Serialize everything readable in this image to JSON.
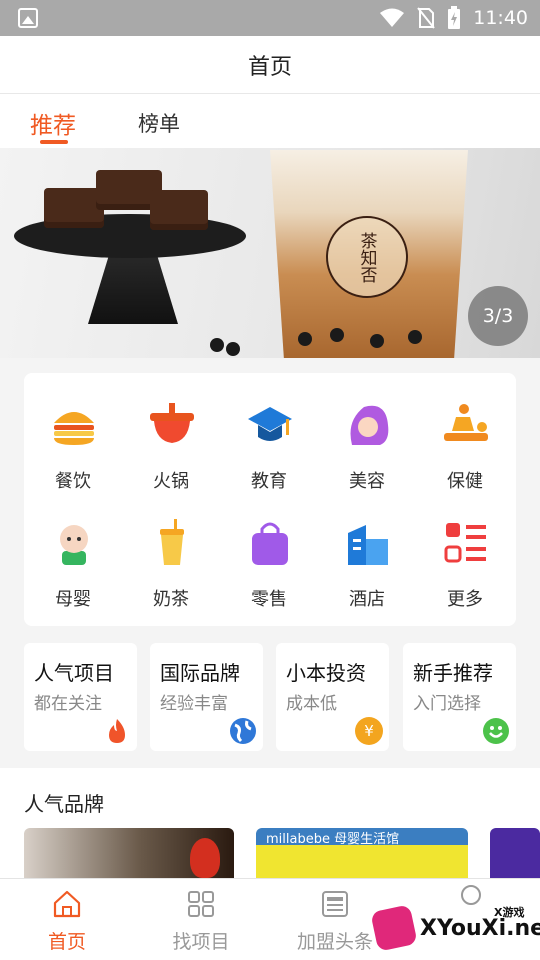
{
  "status_bar": {
    "time": "11:40"
  },
  "header": {
    "title": "首页"
  },
  "tabs": [
    {
      "label": "推荐",
      "active": true
    },
    {
      "label": "榜单",
      "active": false
    }
  ],
  "banner": {
    "brand_text": "茶知否",
    "counter": "3/3"
  },
  "categories": [
    {
      "label": "餐饮",
      "icon": "burger-icon"
    },
    {
      "label": "火锅",
      "icon": "hotpot-icon"
    },
    {
      "label": "教育",
      "icon": "graduation-cap-icon"
    },
    {
      "label": "美容",
      "icon": "woman-hair-icon"
    },
    {
      "label": "保健",
      "icon": "massage-icon"
    },
    {
      "label": "母婴",
      "icon": "baby-icon"
    },
    {
      "label": "奶茶",
      "icon": "milk-tea-icon"
    },
    {
      "label": "零售",
      "icon": "shopping-bag-icon"
    },
    {
      "label": "酒店",
      "icon": "hotel-building-icon"
    },
    {
      "label": "更多",
      "icon": "more-list-icon"
    }
  ],
  "features": [
    {
      "title": "人气项目",
      "subtitle": "都在关注",
      "icon": "flame-icon",
      "color": "#f0542a"
    },
    {
      "title": "国际品牌",
      "subtitle": "经验丰富",
      "icon": "globe-icon",
      "color": "#2f78d8"
    },
    {
      "title": "小本投资",
      "subtitle": "成本低",
      "icon": "yen-coin-icon",
      "color": "#f3a51f",
      "badge_text": "¥"
    },
    {
      "title": "新手推荐",
      "subtitle": "入门选择",
      "icon": "smile-icon",
      "color": "#4cc24a"
    }
  ],
  "popular_brands": {
    "heading": "人气品牌",
    "second_brand_sign": "millabebe  母婴生活馆"
  },
  "bottom_nav": [
    {
      "label": "首页",
      "icon": "home-icon",
      "active": true
    },
    {
      "label": "找项目",
      "icon": "grid-icon",
      "active": false
    },
    {
      "label": "加盟头条",
      "icon": "news-icon",
      "active": false
    },
    {
      "label": "",
      "icon": "user-icon",
      "active": false
    }
  ],
  "watermark": {
    "site": "XYouXi.net",
    "tag": "X游戏"
  },
  "colors": {
    "accent": "#f05a23",
    "status_bar": "#a9a9a9"
  }
}
